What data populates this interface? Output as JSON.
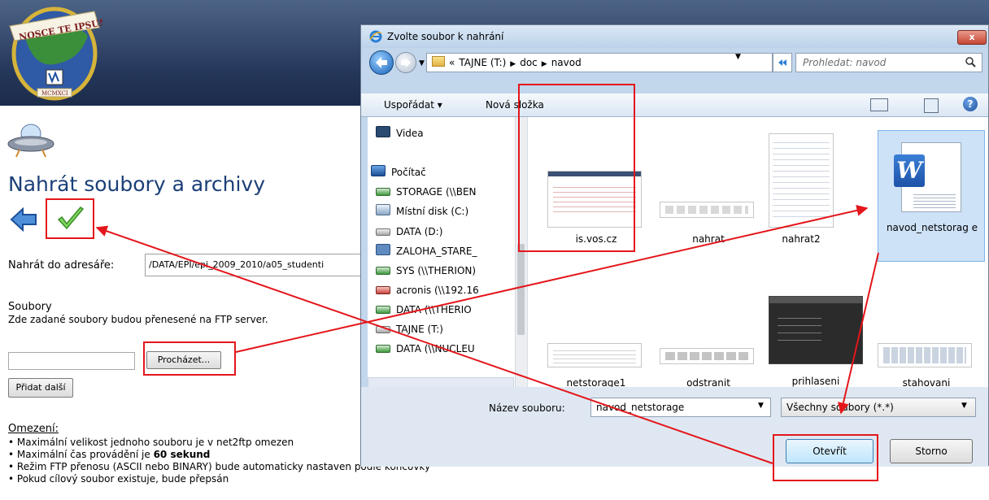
{
  "page": {
    "logo_text": "NOSCE TE IPSUM",
    "logo_year": "MCMXCI",
    "title": "Nahrát soubory a archivy",
    "dir_label": "Nahrát do adresáře:",
    "dir_value": "/DATA/EPI/epi_2009_2010/a05_studenti",
    "files_title": "Soubory",
    "files_desc": "Zde zadané soubory budou přenesené na FTP server.",
    "browse_button": "Procházet...",
    "add_more_button": "Přidat další",
    "limits_title": "Omezení:",
    "limits": [
      "Maximální velikost jednoho souboru je v net2ftp omezen",
      "Maximální čas provádění je 60 sekund",
      "Režim FTP přenosu (ASCII nebo BINARY) bude automaticky nastaven podle koncovky",
      "Pokud cílový soubor existuje, bude přepsán"
    ]
  },
  "dialog": {
    "title": "Zvolte soubor k nahrání",
    "close_label": "x",
    "address": {
      "prefix": "«",
      "crumbs": [
        "TAJNE (T:)",
        "doc",
        "navod"
      ]
    },
    "search_placeholder": "Prohledat: navod",
    "toolbar": {
      "organize": "Uspořádat ▾",
      "new_folder": "Nová složka"
    },
    "nav_items": [
      {
        "label": "Videa",
        "icon": "video-icon"
      },
      {
        "label": "Počítač",
        "icon": "computer-icon"
      },
      {
        "label": "STORAGE (\\\\BEN",
        "icon": "network-drive-icon"
      },
      {
        "label": "Místní disk (C:)",
        "icon": "local-disk-icon"
      },
      {
        "label": "DATA (D:)",
        "icon": "drive-icon"
      },
      {
        "label": "ZALOHA_STARE_",
        "icon": "backup-drive-icon"
      },
      {
        "label": "SYS (\\\\THERION)",
        "icon": "network-drive-icon"
      },
      {
        "label": "acronis (\\\\192.16",
        "icon": "disconnected-drive-icon"
      },
      {
        "label": "DATA (\\\\THERIO",
        "icon": "network-drive-icon"
      },
      {
        "label": "TAJNE (T:)",
        "icon": "drive-icon"
      },
      {
        "label": "DATA (\\\\NUCLEU",
        "icon": "network-drive-icon"
      }
    ],
    "files": [
      {
        "name": "is.vos.cz"
      },
      {
        "name": "nahrat"
      },
      {
        "name": "nahrat2"
      },
      {
        "name": "navod_netstorage"
      },
      {
        "name": "netstorage1"
      },
      {
        "name": "odstranit"
      },
      {
        "name": "prihlaseni"
      },
      {
        "name": "stahovani"
      }
    ],
    "selected_file_label": "navod_netstorag e",
    "filename_label": "Název souboru:",
    "filename_value": "navod_netstorage",
    "filter_value": "Všechny soubory (*.*)",
    "open_button": "Otevřít",
    "cancel_button": "Storno"
  },
  "colors": {
    "highlight": "#e4161b",
    "title_blue": "#1b3f78"
  }
}
